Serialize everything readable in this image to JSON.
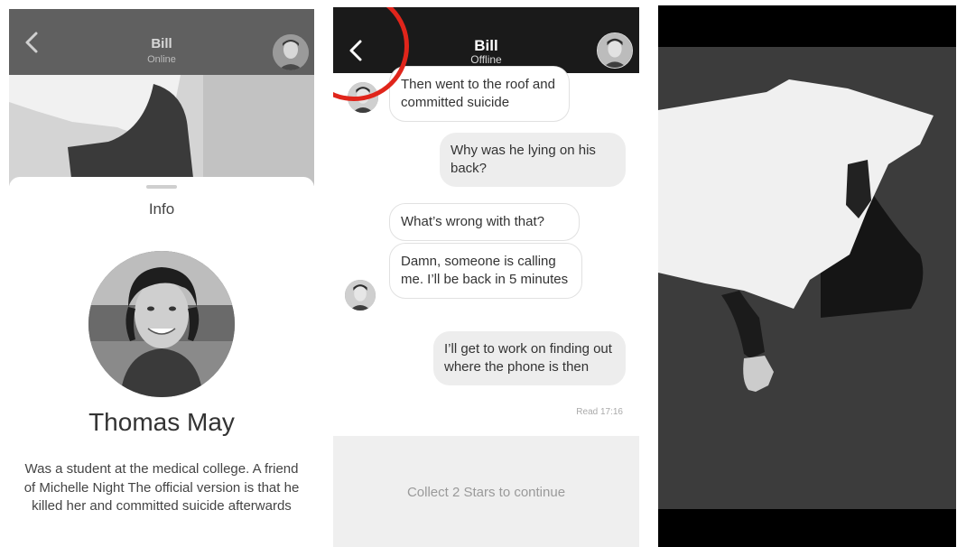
{
  "panel1": {
    "header": {
      "title": "Bill",
      "status": "Online"
    },
    "info_sheet": {
      "heading": "Info",
      "name": "Thomas May",
      "bio": "Was a student at the medical college. A friend of Michelle Night The official version is that he killed her and committed suicide afterwards"
    }
  },
  "panel2": {
    "header": {
      "title": "Bill",
      "status": "Offline"
    },
    "messages": [
      {
        "direction": "in",
        "text": "Then went to the roof and committed suicide"
      },
      {
        "direction": "out",
        "text": "Why was he lying on his back?"
      },
      {
        "direction": "in",
        "text": "What’s wrong with that?"
      },
      {
        "direction": "in",
        "text": "Damn, someone is calling me. I’ll be back in 5 minutes"
      },
      {
        "direction": "out",
        "text": "I’ll get to work on finding out where the phone  is then"
      }
    ],
    "read_receipt": "Read 17:16",
    "footer": {
      "collect_label": "Collect 2 Stars to continue"
    },
    "highlight_color": "#e0251b"
  },
  "panel3": {
    "photo": "black-and-white-photo-body-under-sheet"
  },
  "colors": {
    "header_dark": "#1a1a1a",
    "bubble_out": "#ededed",
    "bubble_in_border": "#e1e1e1",
    "footer_bg": "#efefef"
  }
}
